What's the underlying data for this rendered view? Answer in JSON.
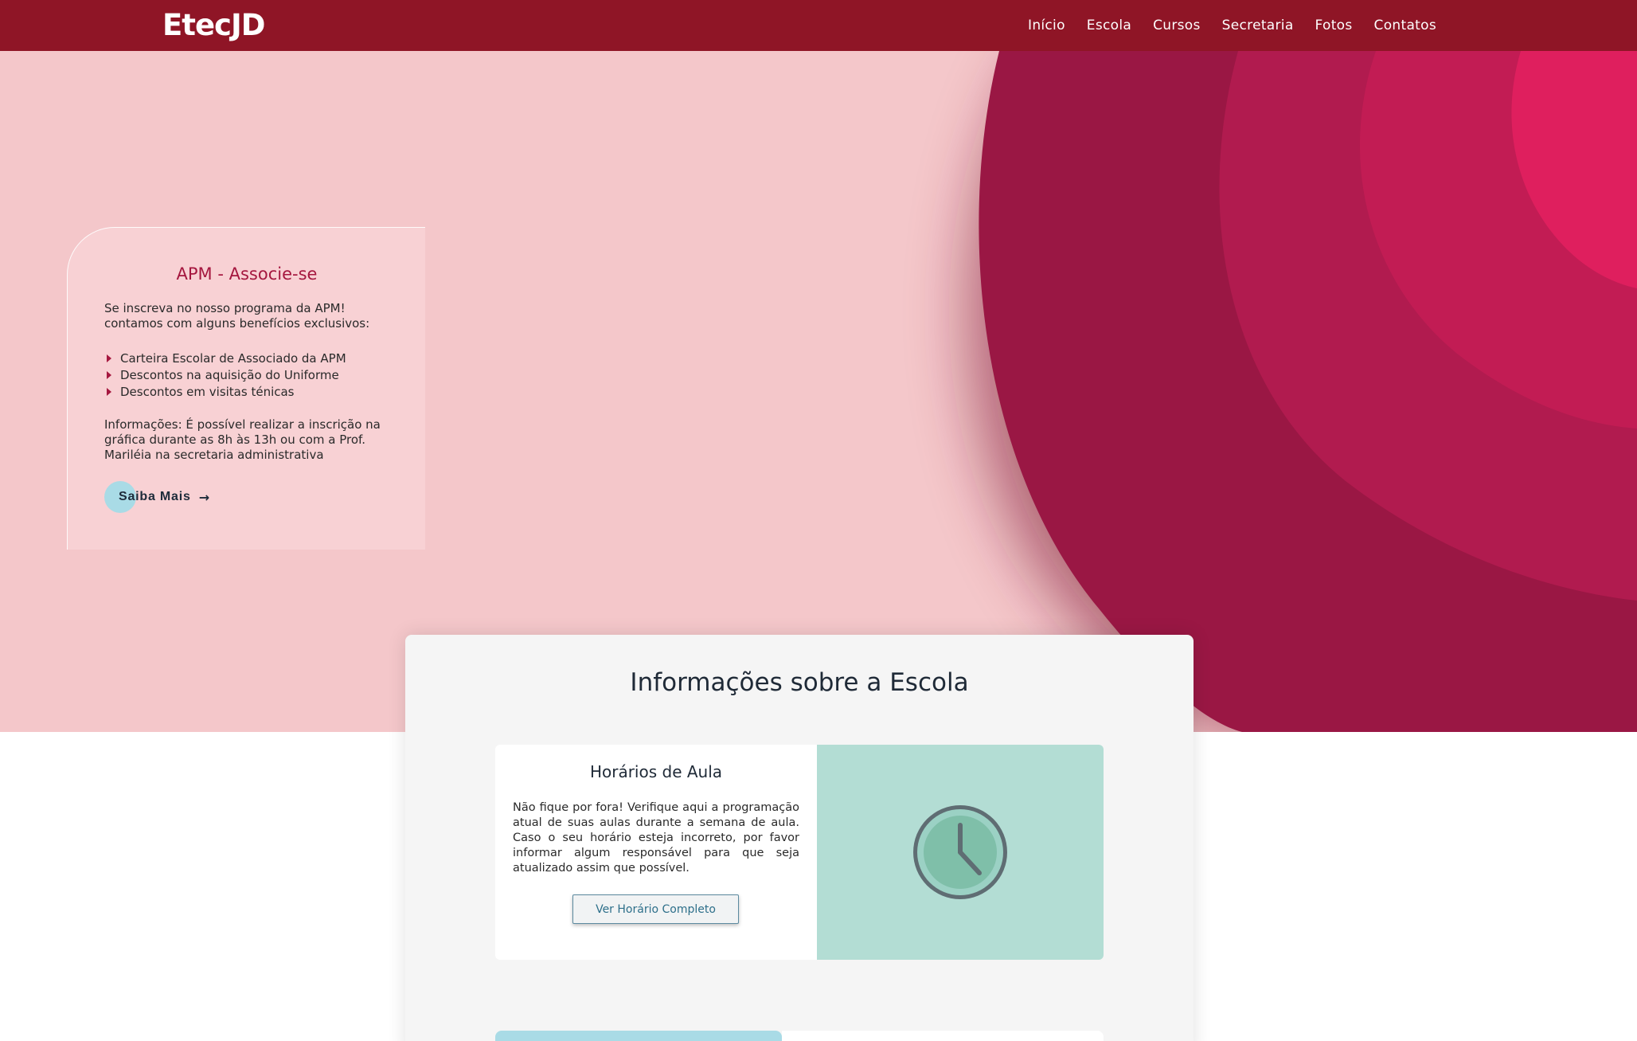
{
  "header": {
    "logo": "EtecJD",
    "nav": [
      "Início",
      "Escola",
      "Cursos",
      "Secretaria",
      "Fotos",
      "Contatos"
    ]
  },
  "apm": {
    "title": "APM - Associe-se",
    "intro_line1": "Se inscreva no nosso programa da APM!",
    "intro_line2": "contamos com alguns benefícios exclusivos:",
    "benefits": [
      "Carteira Escolar de Associado da APM",
      "Descontos na aquisição do Uniforme",
      "Descontos em visitas ténicas"
    ],
    "info_line1": "Informações: É possível realizar a inscrição na",
    "info_line2": "gráfica durante as 8h às 13h ou com a Prof.",
    "info_line3": "Mariléia na secretaria administrativa",
    "cta_label": "Saiba Mais",
    "cta_arrow": "→"
  },
  "info": {
    "title": "Informações sobre a Escola",
    "schedule": {
      "title": "Horários de Aula",
      "text": "Não fique por fora! Verifique aqui a programação atual de suas aulas durante a semana de aula. Caso o seu horário esteja incorreto, por favor informar algum responsável para que seja atualizado assim que possível.",
      "button_label": "Ver Horário Completo",
      "icon": "clock-icon"
    }
  },
  "colors": {
    "navbar": "#8f1526",
    "hero_bg": "#f4c7ca",
    "accent": "#a5173f",
    "clock_panel": "#b3ddd4",
    "saiba_dot": "#a9dbe6"
  }
}
